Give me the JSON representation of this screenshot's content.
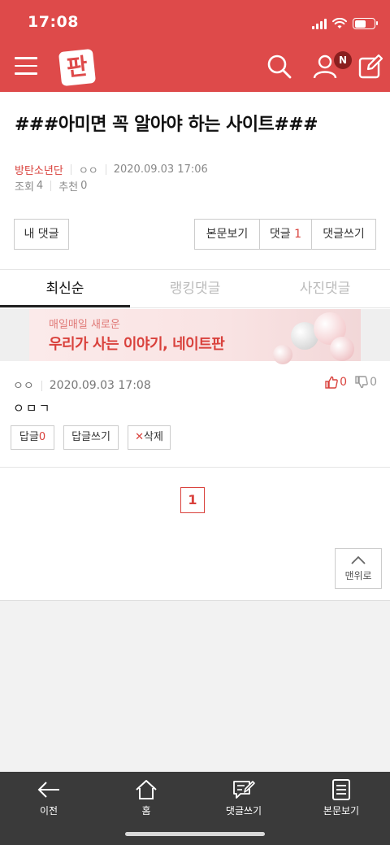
{
  "status_bar": {
    "time": "17:08"
  },
  "header": {
    "logo_text": "판",
    "notification_badge": "N",
    "brand_color": "#de4a4a"
  },
  "post": {
    "title": "###아미면 꼭 알아야 하는 사이트###",
    "author": "방탄소년단",
    "nickname": "ㅇㅇ",
    "date": "2020.09.03 17:06",
    "views_label": "조회",
    "views": "4",
    "recommend_label": "추천",
    "recommend": "0"
  },
  "actions": {
    "my_comments": "내 댓글",
    "view_post": "본문보기",
    "comments_label": "댓글",
    "comments_count": "1",
    "write_comment": "댓글쓰기"
  },
  "tabs": [
    "최신순",
    "랭킹댓글",
    "사진댓글"
  ],
  "ad": {
    "line1": "매일매일 새로운",
    "line2": "우리가 사는 이야기, 네이트판"
  },
  "comment": {
    "nickname": "ㅇㅇ",
    "date": "2020.09.03 17:08",
    "body": "ㅇㅁㄱ",
    "likes": "0",
    "dislikes": "0",
    "reply_label": "답글",
    "reply_count": "0",
    "write_reply": "답글쓰기",
    "delete_mark": "✕",
    "delete": "삭제"
  },
  "pagination": {
    "current": "1"
  },
  "scroll_top": "맨위로",
  "toolbar": {
    "back": "이전",
    "home": "홈",
    "write_comment": "댓글쓰기",
    "view_post": "본문보기"
  }
}
